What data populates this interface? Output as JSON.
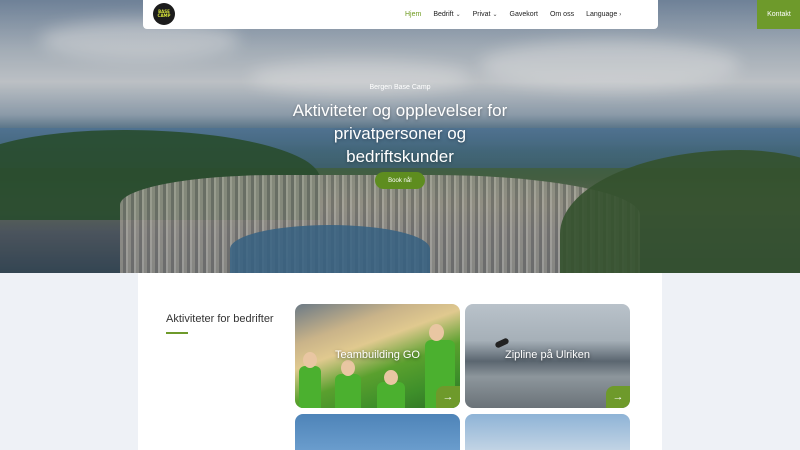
{
  "nav": {
    "logo_text": "BASE CAMP",
    "links": [
      {
        "label": "Hjem",
        "active": true,
        "chevron": ""
      },
      {
        "label": "Bedrift",
        "active": false,
        "chevron": "⌄"
      },
      {
        "label": "Privat",
        "active": false,
        "chevron": "⌄"
      },
      {
        "label": "Gavekort",
        "active": false,
        "chevron": ""
      },
      {
        "label": "Om oss",
        "active": false,
        "chevron": ""
      },
      {
        "label": "Language",
        "active": false,
        "chevron": "›"
      }
    ],
    "contact_label": "Kontakt"
  },
  "hero": {
    "eyebrow": "Bergen Base Camp",
    "title": "Aktiviteter og opplevelser for privatpersoner og bedriftskunder",
    "cta_label": "Book nå!"
  },
  "section": {
    "title": "Aktiviteter for bedrifter",
    "cards": [
      {
        "title": "Teambuilding GO",
        "arrow": "→"
      },
      {
        "title": "Zipline på Ulriken",
        "arrow": "→"
      }
    ]
  },
  "colors": {
    "accent_green": "#6e9a2b",
    "active_nav": "#6e9a1e"
  }
}
